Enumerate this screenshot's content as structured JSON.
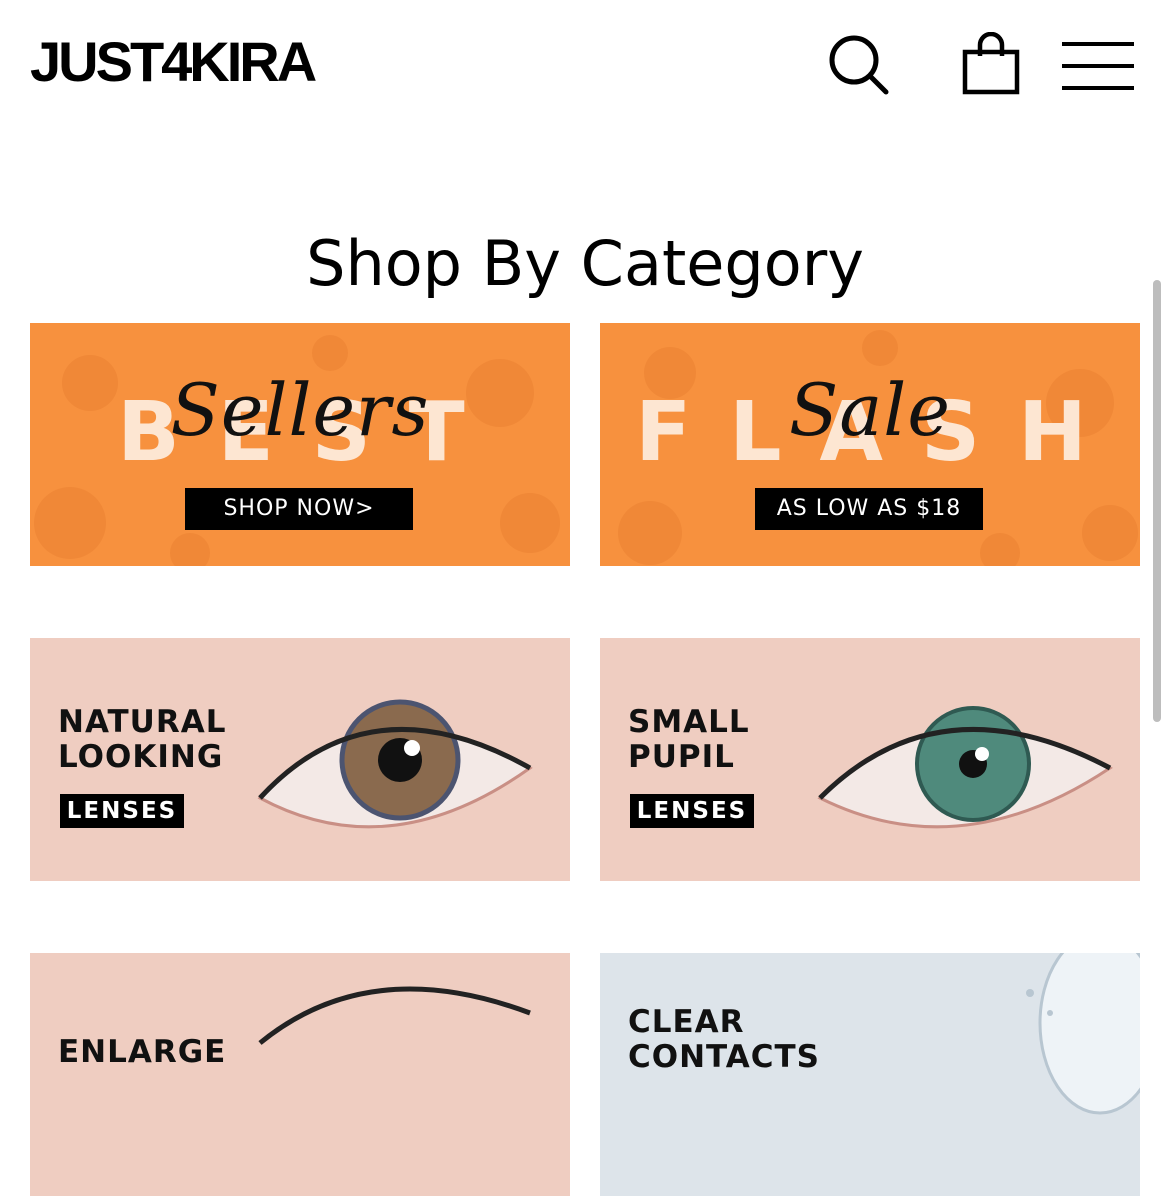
{
  "header": {
    "logo": "JUST4KIRA",
    "icons": [
      "search-icon",
      "shopping-bag-icon",
      "hamburger-menu-icon"
    ]
  },
  "section": {
    "title": "Shop By Category"
  },
  "categories": [
    {
      "big_text": "BEST",
      "script_text": "Sellers",
      "button": "SHOP NOW>"
    },
    {
      "big_text": "FLASH",
      "script_text": "Sale",
      "button": "AS LOW AS $18"
    },
    {
      "line1": "NATURAL",
      "line2": "LOOKING",
      "badge": "LENSES",
      "iris_color": "#8a6a4e"
    },
    {
      "line1": "SMALL",
      "line2": "PUPIL",
      "badge": "LENSES",
      "iris_color": "#4f8a7c"
    },
    {
      "line1": "ENLARGE",
      "iris_color": "#6b5a4a"
    },
    {
      "line1": "CLEAR",
      "line2": "CONTACTS"
    }
  ],
  "colors": {
    "promo_orange": "#f7913e",
    "eye_background": "#efcdc1",
    "badge_black": "#000000"
  }
}
